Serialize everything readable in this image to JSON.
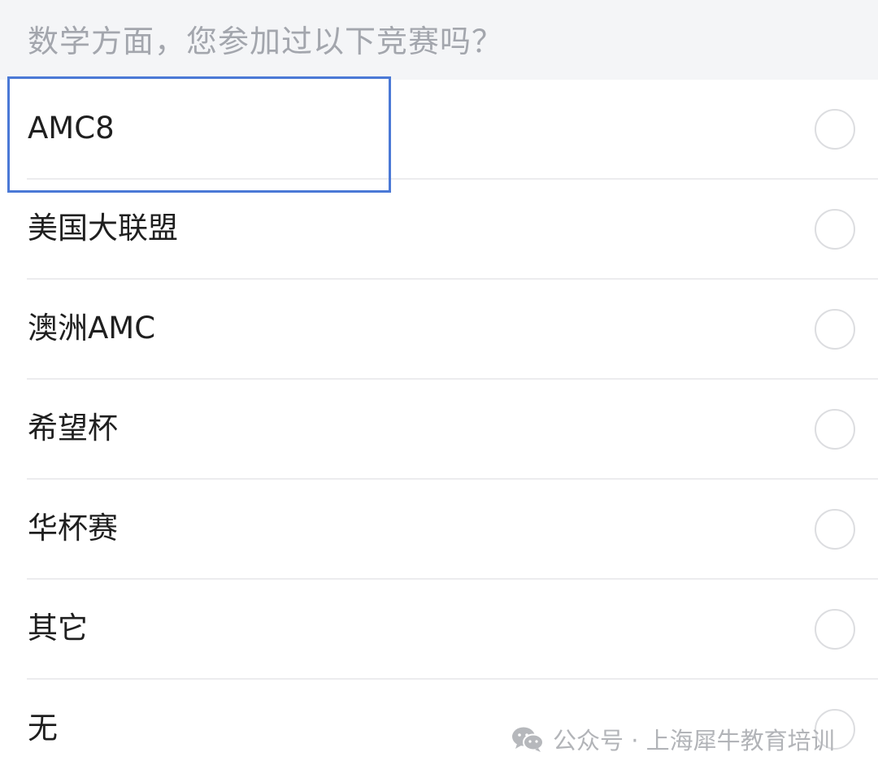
{
  "question": {
    "text": "数学方面，您参加过以下竞赛吗？"
  },
  "options": [
    {
      "label": "AMC8"
    },
    {
      "label": "美国大联盟"
    },
    {
      "label": "澳洲AMC"
    },
    {
      "label": "希望杯"
    },
    {
      "label": "华杯赛"
    },
    {
      "label": "其它"
    },
    {
      "label": "无"
    }
  ],
  "highlight": {
    "color": "#4b79d6"
  },
  "watermark": {
    "icon": "wechat-icon",
    "text": "公众号 · 上海犀牛教育培训"
  }
}
